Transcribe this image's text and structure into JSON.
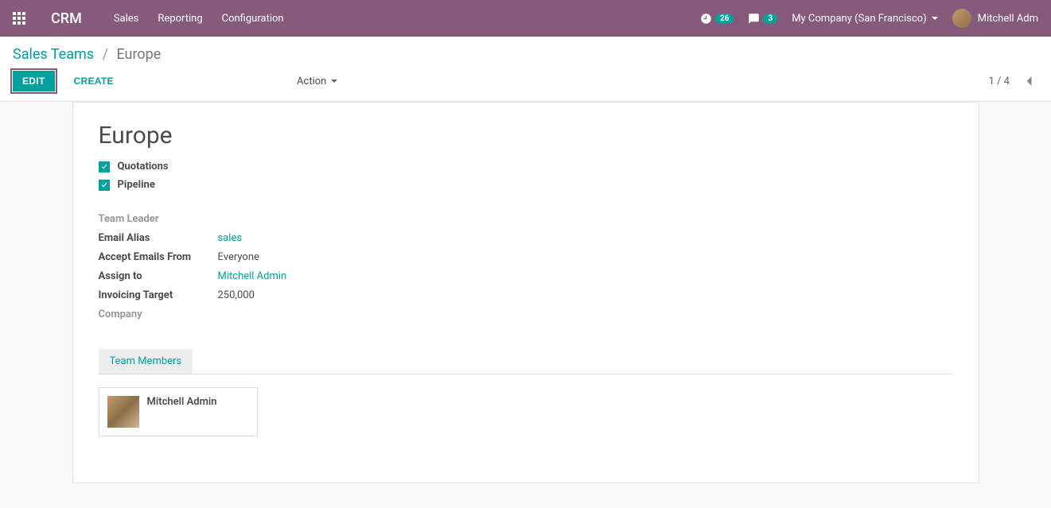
{
  "navbar": {
    "brand": "CRM",
    "menu": [
      "Sales",
      "Reporting",
      "Configuration"
    ],
    "activities_count": "26",
    "messages_count": "3",
    "company": "My Company (San Francisco)",
    "user": "Mitchell Adm"
  },
  "breadcrumb": {
    "parent": "Sales Teams",
    "current": "Europe"
  },
  "toolbar": {
    "edit": "Edit",
    "create": "Create",
    "action": "Action"
  },
  "pager": {
    "text": "1 / 4"
  },
  "form": {
    "title": "Europe",
    "checkboxes": {
      "quotations": "Quotations",
      "pipeline": "Pipeline"
    },
    "fields": {
      "team_leader_label": "Team Leader",
      "email_alias_label": "Email Alias",
      "email_alias_value": "sales",
      "accept_emails_label": "Accept Emails From",
      "accept_emails_value": "Everyone",
      "assign_to_label": "Assign to",
      "assign_to_value": "Mitchell Admin",
      "invoicing_target_label": "Invoicing Target",
      "invoicing_target_value": "250,000",
      "company_label": "Company"
    },
    "tab_label": "Team Members",
    "members": [
      {
        "name": "Mitchell Admin"
      }
    ]
  }
}
